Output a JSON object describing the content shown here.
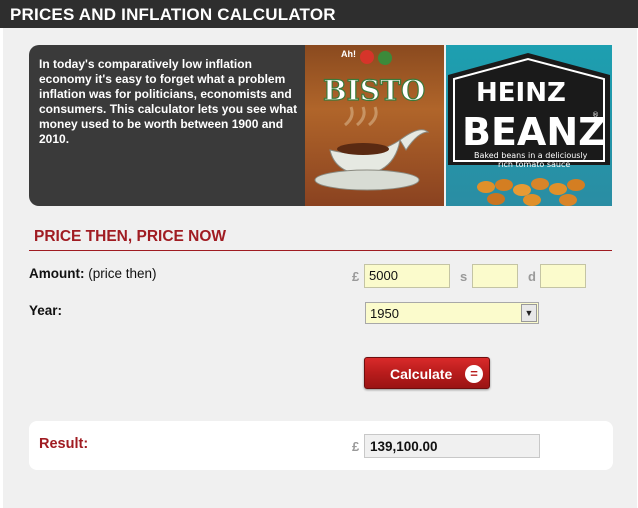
{
  "header": {
    "title": "PRICES AND INFLATION CALCULATOR"
  },
  "intro": {
    "text": "In today's comparatively low inflation economy it's easy to forget what a problem inflation was for politicians, economists and consumers. This calculator lets you see what money used to be worth between 1900 and 2010."
  },
  "images": {
    "bisto": {
      "tagline": "Ah!",
      "brand": "BISTO"
    },
    "beanz": {
      "brand_top": "HEINZ",
      "brand_bottom": "BEANZ",
      "reg": "®",
      "tagline_1": "Baked beans in a deliciously",
      "tagline_2": "rich tomato sauce"
    }
  },
  "section": {
    "heading": "PRICE THEN, PRICE NOW"
  },
  "amount": {
    "label_bold": "Amount:",
    "label_rest": " (price then)",
    "pounds_symbol": "£",
    "pounds_value": "5000",
    "shillings_symbol": "s",
    "shillings_value": "",
    "pence_symbol": "d",
    "pence_value": ""
  },
  "year": {
    "label": "Year:",
    "selected": "1950"
  },
  "calculate": {
    "label": "Calculate",
    "icon_glyph": "="
  },
  "result": {
    "label": "Result:",
    "currency_symbol": "£",
    "value": "139,100.00"
  },
  "colors": {
    "accent": "#a01c22",
    "header_bg": "#2e2e2e",
    "field_bg": "#fbfbcc",
    "button_red": "#c41f1f"
  }
}
